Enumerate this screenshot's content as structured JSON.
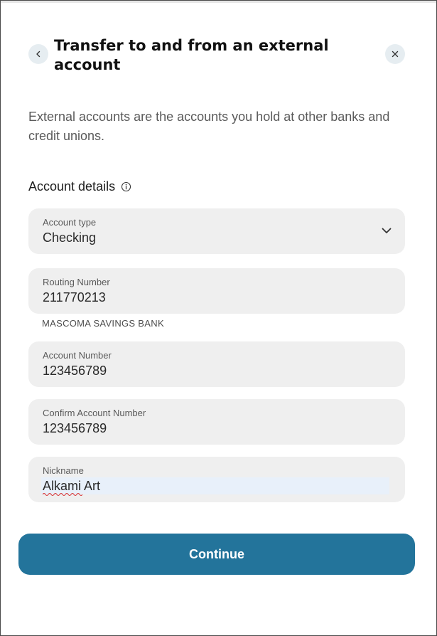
{
  "header": {
    "title": "Transfer to and from an external account",
    "back_icon": "chevron-left-icon",
    "close_icon": "close-icon"
  },
  "intro": "External accounts are the accounts you hold at other banks and credit unions.",
  "section": {
    "title": "Account details",
    "info_icon": "info-icon"
  },
  "fields": {
    "account_type": {
      "label": "Account type",
      "value": "Checking"
    },
    "routing_number": {
      "label": "Routing Number",
      "value": "211770213",
      "helper": "MASCOMA SAVINGS BANK"
    },
    "account_number": {
      "label": "Account Number",
      "value": "123456789"
    },
    "confirm_account_number": {
      "label": "Confirm Account Number",
      "value": "123456789"
    },
    "nickname": {
      "label": "Nickname",
      "value": "Alkami Art"
    }
  },
  "actions": {
    "continue_label": "Continue"
  },
  "colors": {
    "primary": "#23749b",
    "field_bg": "#efefef",
    "icon_bg": "#e6edf1"
  }
}
